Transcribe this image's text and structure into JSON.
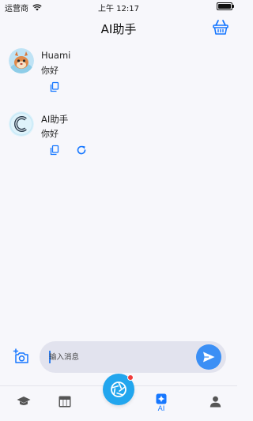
{
  "status_bar": {
    "carrier": "运营商",
    "time": "上午 12:17",
    "battery_level": 1.0
  },
  "header": {
    "title": "AI助手",
    "action_icon": "basket-icon"
  },
  "messages": [
    {
      "sender": "Huami",
      "text": "你好",
      "avatar": "user-avatar",
      "actions": [
        "copy-icon"
      ]
    },
    {
      "sender": "AI助手",
      "text": "你好",
      "avatar": "ai-avatar",
      "actions": [
        "copy-icon",
        "refresh-icon"
      ]
    }
  ],
  "composer": {
    "placeholder": "输入消息",
    "value": "",
    "camera_icon": "camera-plus-icon",
    "send_icon": "send-icon"
  },
  "tab_bar": {
    "tabs": [
      {
        "icon": "graduation-cap-icon",
        "label": "",
        "active": false
      },
      {
        "icon": "table-icon",
        "label": "",
        "active": false
      },
      {
        "icon": "ai-sparkle-icon",
        "label": "AI",
        "active": true
      },
      {
        "icon": "person-icon",
        "label": "",
        "active": false
      }
    ],
    "fab_icon": "aperture-icon",
    "fab_badge": true
  },
  "colors": {
    "accent": "#1677ff",
    "send_button": "#3b8ff5",
    "fab": "#22a6ee",
    "badge": "#f03b3b",
    "input_bg": "#e2e3ee",
    "background": "#f7f7fb"
  }
}
